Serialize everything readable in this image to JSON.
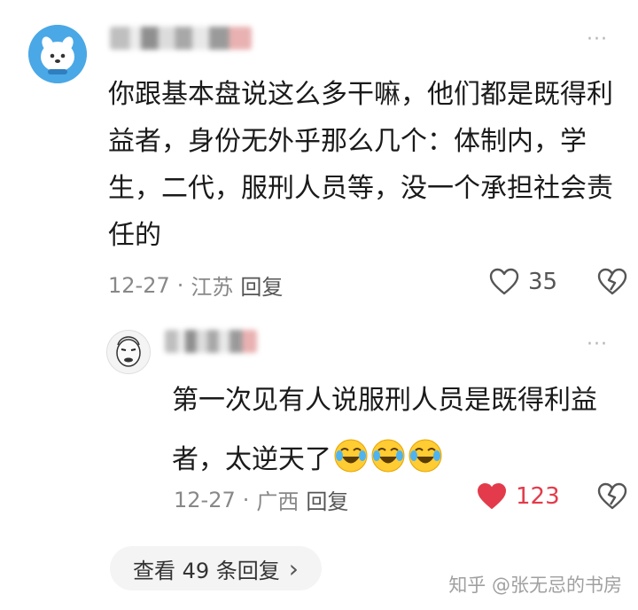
{
  "comment1": {
    "text": "你跟基本盘说这么多干嘛，他们都是既得利益者，身份无外乎那么几个：体制内，学生，二代，服刑人员等，没一个承担社会责任的",
    "date": "12-27",
    "separator": "·",
    "location": "江苏",
    "reply_label": "回复",
    "like_count": "35",
    "like_icon": "heart-outline-icon",
    "dislike_icon": "broken-heart-icon"
  },
  "comment2": {
    "text": "第一次见有人说服刑人员是既得利益者，太逆天了",
    "emoji": [
      "laugh-cry-emoji",
      "laugh-cry-emoji",
      "laugh-cry-emoji"
    ],
    "date": "12-27",
    "separator": "·",
    "location": "广西",
    "reply_label": "回复",
    "like_count": "123",
    "like_icon": "heart-filled-icon",
    "dislike_icon": "broken-heart-icon",
    "like_color": "#e33b4b"
  },
  "view_replies": {
    "label": "查看 49 条回复",
    "chevron": "›"
  },
  "more_glyph": "···",
  "watermark": "知乎 @张无忌的书房"
}
